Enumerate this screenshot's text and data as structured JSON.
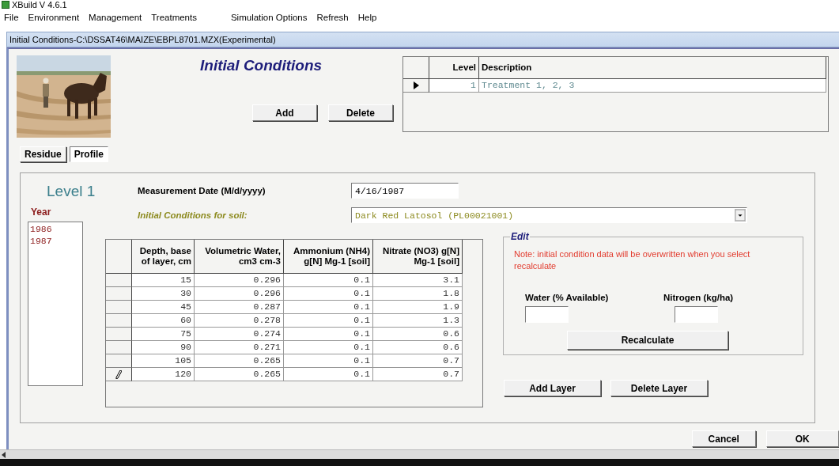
{
  "app": {
    "title": "XBuild V 4.6.1"
  },
  "menu": [
    "File",
    "Environment",
    "Management",
    "Treatments",
    "Simulation Options",
    "Refresh",
    "Help"
  ],
  "window": {
    "title": "Initial Conditions-C:\\DSSAT46\\MAIZE\\EBPL8701.MZX(Experimental)"
  },
  "header": {
    "title": "Initial Conditions",
    "buttons": [
      "Add",
      "Delete"
    ]
  },
  "levels_table": {
    "columns": [
      "Level",
      "Description"
    ],
    "rows": [
      {
        "cells": [
          "1",
          "Treatment 1, 2, 3"
        ],
        "selected": true
      }
    ]
  },
  "tabs": [
    {
      "label": "Residue",
      "selected": false
    },
    {
      "label": "Profile",
      "selected": true
    }
  ],
  "level_heading": "Level 1",
  "year": {
    "label": "Year",
    "items": [
      "1986",
      "1987"
    ]
  },
  "measurement_date": {
    "label": "Measurement Date (M/d/yyyy)",
    "value": "4/16/1987"
  },
  "soil": {
    "label": "Initial Conditions for soil:",
    "value": "Dark Red Latosol (PL00021001)"
  },
  "layers_table": {
    "columns": [
      "Depth, base of layer, cm",
      "Volumetric Water, cm3 cm-3",
      "Ammonium (NH4) g[N] Mg-1 [soil]",
      "Nitrate (NO3) g[N] Mg-1 [soil]"
    ],
    "rows": [
      {
        "cells": [
          "15",
          "0.296",
          "0.1",
          "3.1"
        ],
        "editing": false
      },
      {
        "cells": [
          "30",
          "0.296",
          "0.1",
          "1.8"
        ],
        "editing": false
      },
      {
        "cells": [
          "45",
          "0.287",
          "0.1",
          "1.9"
        ],
        "editing": false
      },
      {
        "cells": [
          "60",
          "0.278",
          "0.1",
          "1.3"
        ],
        "editing": false
      },
      {
        "cells": [
          "75",
          "0.274",
          "0.1",
          "0.6"
        ],
        "editing": false
      },
      {
        "cells": [
          "90",
          "0.271",
          "0.1",
          "0.6"
        ],
        "editing": false
      },
      {
        "cells": [
          "105",
          "0.265",
          "0.1",
          "0.7"
        ],
        "editing": false
      },
      {
        "cells": [
          "120",
          "0.265",
          "0.1",
          "0.7"
        ],
        "editing": true
      }
    ]
  },
  "edit": {
    "title": "Edit",
    "note": "Note: initial condition data will be overwritten when you select recalculate",
    "fields": [
      {
        "label": "Water (% Available)"
      },
      {
        "label": "Nitrogen (kg/ha)"
      }
    ],
    "button": "Recalculate"
  },
  "layer_buttons": [
    "Add Layer",
    "Delete Layer"
  ],
  "dialog_buttons": [
    "Cancel",
    "OK"
  ]
}
